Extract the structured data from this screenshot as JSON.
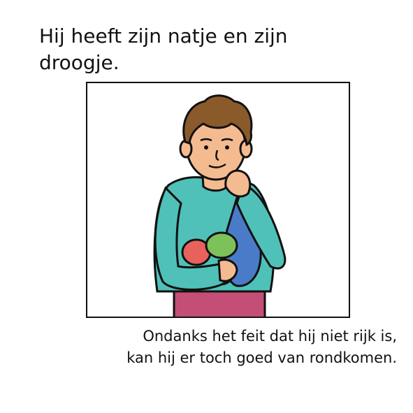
{
  "title": "Hij heeft zijn natje en zijn droogje.",
  "caption": {
    "line1": "Ondanks het feit dat hij niet rijk is,",
    "line2": "kan hij er toch goed van rondkomen."
  },
  "illustration": {
    "subject": "man-holding-food-and-bag-icon",
    "colors": {
      "skin": "#F5BB90",
      "hair": "#8B5A2B",
      "sweater": "#4FC1B8",
      "bag": "#4A7BC8",
      "pants": "#C44E75",
      "food_red": "#E8625B",
      "food_green": "#7DC15A",
      "food_yellow": "#E9C86A",
      "outline": "#111111"
    }
  }
}
